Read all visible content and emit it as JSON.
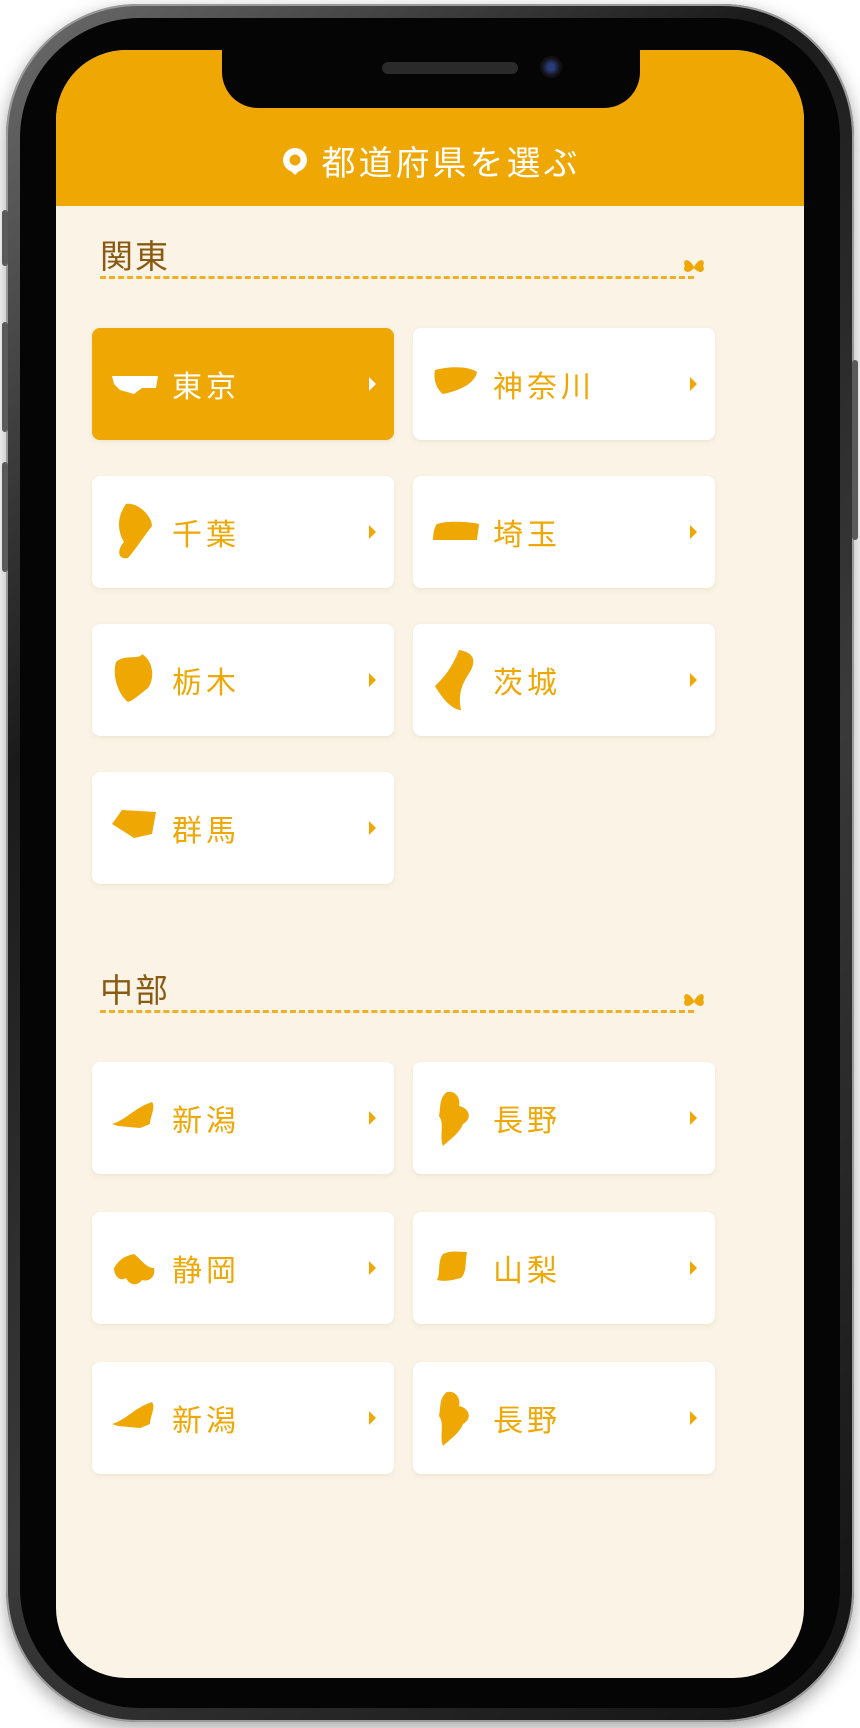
{
  "header": {
    "title": "都道府県を選ぶ",
    "icon": "map-pin-icon",
    "color": "#efa704"
  },
  "sections": [
    {
      "title": "関東",
      "items": [
        {
          "label": "東京",
          "active": true
        },
        {
          "label": "神奈川"
        },
        {
          "label": "千葉"
        },
        {
          "label": "埼玉"
        },
        {
          "label": "栃木"
        },
        {
          "label": "茨城"
        },
        {
          "label": "群馬"
        }
      ]
    },
    {
      "title": "中部",
      "items": [
        {
          "label": "新潟"
        },
        {
          "label": "長野"
        },
        {
          "label": "静岡"
        },
        {
          "label": "山梨"
        },
        {
          "label": "新潟"
        },
        {
          "label": "長野"
        }
      ]
    }
  ],
  "colors": {
    "accent": "#efa704",
    "background": "#faf3e6",
    "section_title": "#8a5a12",
    "card": "#ffffff"
  }
}
